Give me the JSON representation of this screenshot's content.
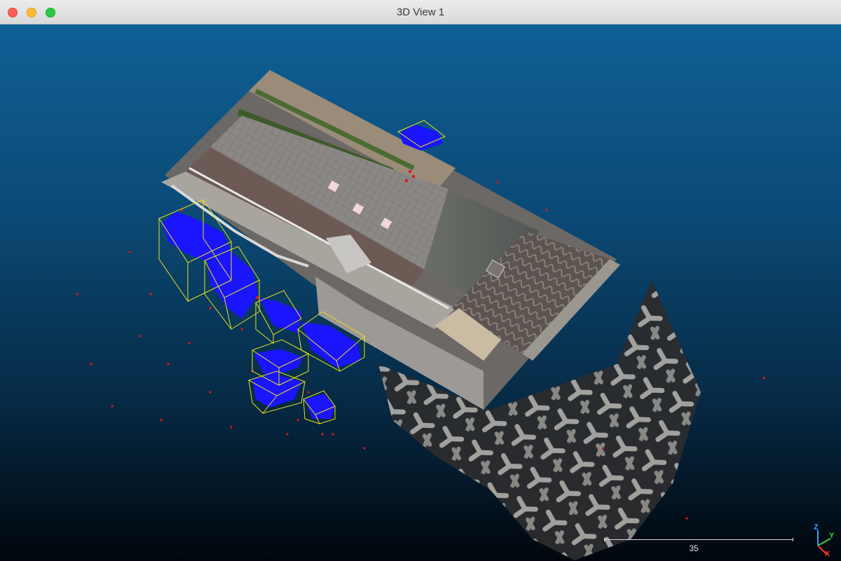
{
  "window": {
    "title": "3D View 1"
  },
  "scale_bar": {
    "value": "35"
  },
  "axes": {
    "z": "Z",
    "y": "Y",
    "x": "X"
  },
  "colors": {
    "selection": "#1a14ff",
    "bbox": "#e8e21a",
    "outlier": "#e0161a"
  },
  "icons": {
    "close": "close-icon",
    "minimize": "minimize-icon",
    "zoom": "zoom-icon"
  }
}
